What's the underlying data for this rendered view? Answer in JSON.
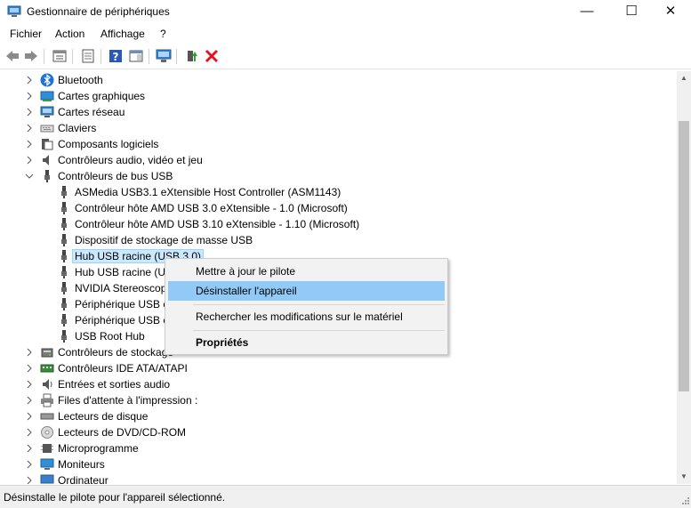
{
  "window": {
    "title": "Gestionnaire de périphériques",
    "minimize": "—",
    "maximize": "☐",
    "close": "✕"
  },
  "menu": [
    "Fichier",
    "Action",
    "Affichage",
    "?"
  ],
  "toolbar": {
    "buttons": [
      "back-icon",
      "forward-icon",
      "properties-icon",
      "view-icon",
      "help-icon",
      "action-pane-icon",
      "scan-hardware-icon",
      "update-driver-icon",
      "uninstall-icon"
    ]
  },
  "tree": {
    "items": [
      {
        "label": "Bluetooth",
        "level": 0,
        "expander": ">",
        "icon": "bluetooth-icon"
      },
      {
        "label": "Cartes graphiques",
        "level": 0,
        "expander": ">",
        "icon": "display-adapter-icon"
      },
      {
        "label": "Cartes réseau",
        "level": 0,
        "expander": ">",
        "icon": "network-adapter-icon"
      },
      {
        "label": "Claviers",
        "level": 0,
        "expander": ">",
        "icon": "keyboard-icon"
      },
      {
        "label": "Composants logiciels",
        "level": 0,
        "expander": ">",
        "icon": "software-component-icon"
      },
      {
        "label": "Contrôleurs audio, vidéo et jeu",
        "level": 0,
        "expander": ">",
        "icon": "audio-icon"
      },
      {
        "label": "Contrôleurs de bus USB",
        "level": 0,
        "expander": "v",
        "icon": "usb-icon"
      },
      {
        "label": "ASMedia USB3.1 eXtensible Host Controller (ASM1143)",
        "level": 1,
        "expander": "",
        "icon": "usb-icon"
      },
      {
        "label": "Contrôleur hôte AMD USB 3.0 eXtensible - 1.0 (Microsoft)",
        "level": 1,
        "expander": "",
        "icon": "usb-icon"
      },
      {
        "label": "Contrôleur hôte AMD USB 3.10 eXtensible - 1.10 (Microsoft)",
        "level": 1,
        "expander": "",
        "icon": "usb-icon"
      },
      {
        "label": "Dispositif de stockage de masse USB",
        "level": 1,
        "expander": "",
        "icon": "usb-icon"
      },
      {
        "label": "Hub USB racine (USB 3.0)",
        "level": 1,
        "expander": "",
        "icon": "usb-icon",
        "selected": true
      },
      {
        "label": "Hub USB racine (US",
        "level": 1,
        "expander": "",
        "icon": "usb-icon"
      },
      {
        "label": "NVIDIA Stereoscop",
        "level": 1,
        "expander": "",
        "icon": "usb-icon"
      },
      {
        "label": "Périphérique USB c",
        "level": 1,
        "expander": "",
        "icon": "usb-icon"
      },
      {
        "label": "Périphérique USB c",
        "level": 1,
        "expander": "",
        "icon": "usb-icon"
      },
      {
        "label": "USB Root Hub",
        "level": 1,
        "expander": "",
        "icon": "usb-icon"
      },
      {
        "label": "Contrôleurs de stockage",
        "level": 0,
        "expander": ">",
        "icon": "storage-controller-icon"
      },
      {
        "label": "Contrôleurs IDE ATA/ATAPI",
        "level": 0,
        "expander": ">",
        "icon": "ide-controller-icon"
      },
      {
        "label": "Entrées et sorties audio",
        "level": 0,
        "expander": ">",
        "icon": "speaker-icon"
      },
      {
        "label": "Files d'attente à l'impression :",
        "level": 0,
        "expander": ">",
        "icon": "printer-icon"
      },
      {
        "label": "Lecteurs de disque",
        "level": 0,
        "expander": ">",
        "icon": "disk-drive-icon"
      },
      {
        "label": "Lecteurs de DVD/CD-ROM",
        "level": 0,
        "expander": ">",
        "icon": "dvd-icon"
      },
      {
        "label": "Microprogramme",
        "level": 0,
        "expander": ">",
        "icon": "firmware-icon"
      },
      {
        "label": "Moniteurs",
        "level": 0,
        "expander": ">",
        "icon": "monitor-icon"
      },
      {
        "label": "Ordinateur",
        "level": 0,
        "expander": ">",
        "icon": "computer-icon"
      }
    ]
  },
  "context_menu": {
    "items": [
      {
        "label": "Mettre à jour le pilote"
      },
      {
        "label": "Désinstaller l'appareil",
        "highlighted": true
      },
      {
        "label": "Rechercher les modifications sur le matériel"
      },
      {
        "label": "Propriétés",
        "bold": true
      }
    ]
  },
  "status": {
    "text": "Désinstalle le pilote pour l'appareil sélectionné."
  },
  "colors": {
    "selection": "#cce8ff",
    "menu_highlight": "#91c9f7",
    "uninstall_red": "#e81123",
    "bluetooth_blue": "#1e73d6"
  }
}
